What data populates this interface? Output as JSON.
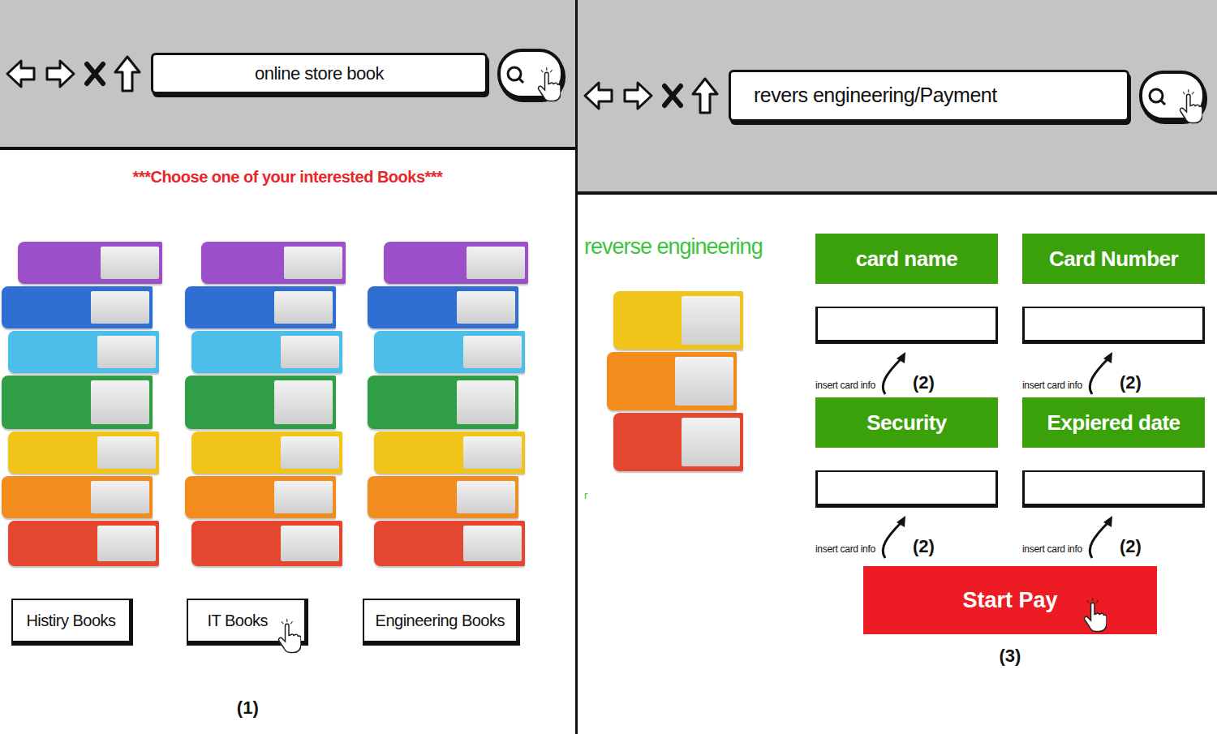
{
  "store_page": {
    "address": "online store book",
    "heading": "***Choose one of your interested Books***",
    "categories": [
      {
        "label": "Histiry Books",
        "selected": false
      },
      {
        "label": "IT Books",
        "selected": true
      },
      {
        "label": "Engineering Books",
        "selected": false
      }
    ],
    "step": "(1)"
  },
  "payment_page": {
    "address": "revers engineering/Payment",
    "title": "reverse engineering",
    "stray_text": "r",
    "fields": [
      {
        "label": "card name",
        "hint": "insert card info",
        "step": "(2)"
      },
      {
        "label": "Card Number",
        "hint": "insert card info",
        "step": "(2)"
      },
      {
        "label": "Security",
        "hint": "insert card info",
        "step": "(2)"
      },
      {
        "label": "Expiered date",
        "hint": "insert card info",
        "step": "(2)"
      }
    ],
    "button": "Start Pay",
    "step": "(3)"
  }
}
